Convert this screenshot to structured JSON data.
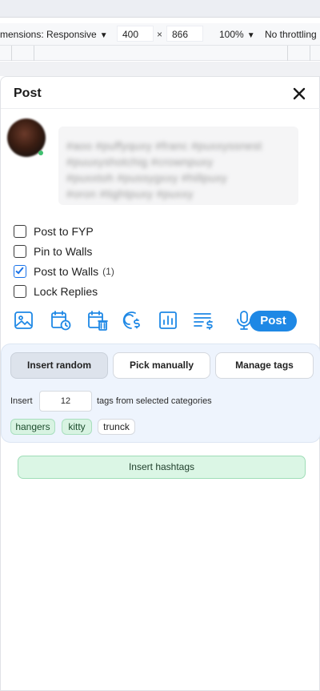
{
  "devtools": {
    "dimensions_label": "mensions: Responsive",
    "width_value": "400",
    "times": "×",
    "height_value": "866",
    "zoom": "100%",
    "throttle": "No throttling"
  },
  "panel": {
    "title": "Post",
    "blurred_lines": [
      "#aoo #puffyquxy #franc #puxxyssnest",
      "#puuxyshotchig #crownpuxy",
      "#puxxtoh #pussygxxy #hillpuxy",
      "#oron #tightpuxy #puxxy"
    ]
  },
  "checkboxes": [
    {
      "label": "Post to FYP",
      "checked": false,
      "count": ""
    },
    {
      "label": "Pin to Walls",
      "checked": false,
      "count": ""
    },
    {
      "label": "Post to Walls",
      "checked": true,
      "count": "(1)"
    },
    {
      "label": "Lock Replies",
      "checked": false,
      "count": ""
    }
  ],
  "toolbar": {
    "icons": [
      "image-icon",
      "schedule-icon",
      "calendar-delete-icon",
      "paid-icon",
      "stats-icon",
      "price-list-icon",
      "microphone-icon"
    ],
    "post_label": "Post",
    "accent": "#1e88e5"
  },
  "tags": {
    "insert_random": "Insert random",
    "pick_manually": "Pick manually",
    "manage_tags": "Manage tags",
    "insert_label": "Insert",
    "insert_count": "12",
    "insert_suffix": "tags from selected categories",
    "chips": [
      {
        "label": "hangers",
        "selected": true
      },
      {
        "label": "kitty",
        "selected": true
      },
      {
        "label": "trunck",
        "selected": false
      }
    ],
    "insert_hashtags": "Insert hashtags"
  }
}
